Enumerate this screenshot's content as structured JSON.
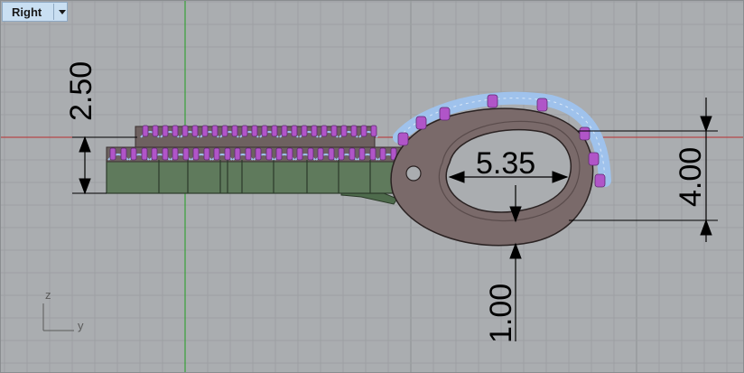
{
  "viewport": {
    "name": "Right",
    "axis_labels": {
      "vertical": "z",
      "horizontal": "y"
    }
  },
  "dimensions": [
    {
      "id": "height-left",
      "value": "2.50"
    },
    {
      "id": "loop-width",
      "value": "5.35"
    },
    {
      "id": "loop-height",
      "value": "4.00"
    },
    {
      "id": "bottom-gap",
      "value": "1.00"
    }
  ],
  "colors": {
    "background": "#aaadb0",
    "grid_minor": "#a0a3a6",
    "grid_major": "#8e9194",
    "x_axis": "#b83030",
    "z_axis": "#20a020",
    "dimension": "#000000",
    "metal": "#7a6a6a",
    "body": "#5f7a5c",
    "prong": "#b055c8",
    "setting": "#9fc2ec"
  }
}
